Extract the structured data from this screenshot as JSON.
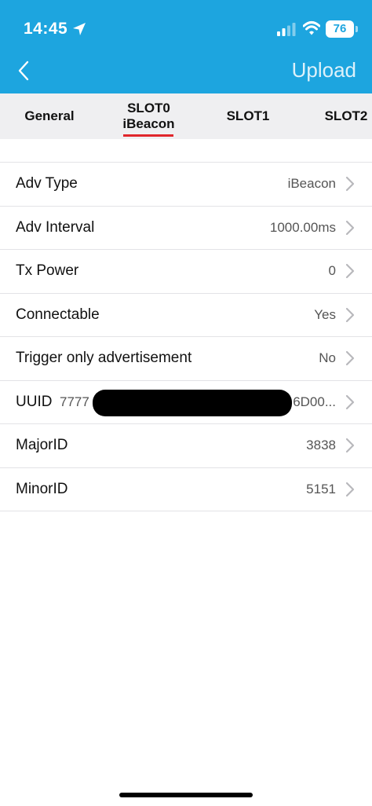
{
  "status_bar": {
    "time": "14:45",
    "battery": "76",
    "icons": [
      "location-arrow-icon",
      "cellular-signal-icon",
      "wifi-icon",
      "battery-icon"
    ]
  },
  "header": {
    "back_icon": "chevron-left-icon",
    "upload_label": "Upload",
    "background_color": "#1DA5DF"
  },
  "tabs": [
    {
      "label": "General"
    },
    {
      "label": "SLOT0",
      "sublabel": "iBeacon",
      "active": true
    },
    {
      "label": "SLOT1"
    },
    {
      "label": "SLOT2"
    }
  ],
  "accent_color": "#E0262B",
  "settings": [
    {
      "label": "Adv Type",
      "value": "iBeacon"
    },
    {
      "label": "Adv Interval",
      "value": "1000.00ms"
    },
    {
      "label": "Tx Power",
      "value": "0"
    },
    {
      "label": "Connectable",
      "value": "Yes"
    },
    {
      "label": "Trigger only advertisement",
      "value": "No"
    },
    {
      "label": "UUID",
      "value_start": "7777",
      "value_end": "6D00..."
    },
    {
      "label": "MajorID",
      "value": "3838"
    },
    {
      "label": "MinorID",
      "value": "5151"
    }
  ]
}
